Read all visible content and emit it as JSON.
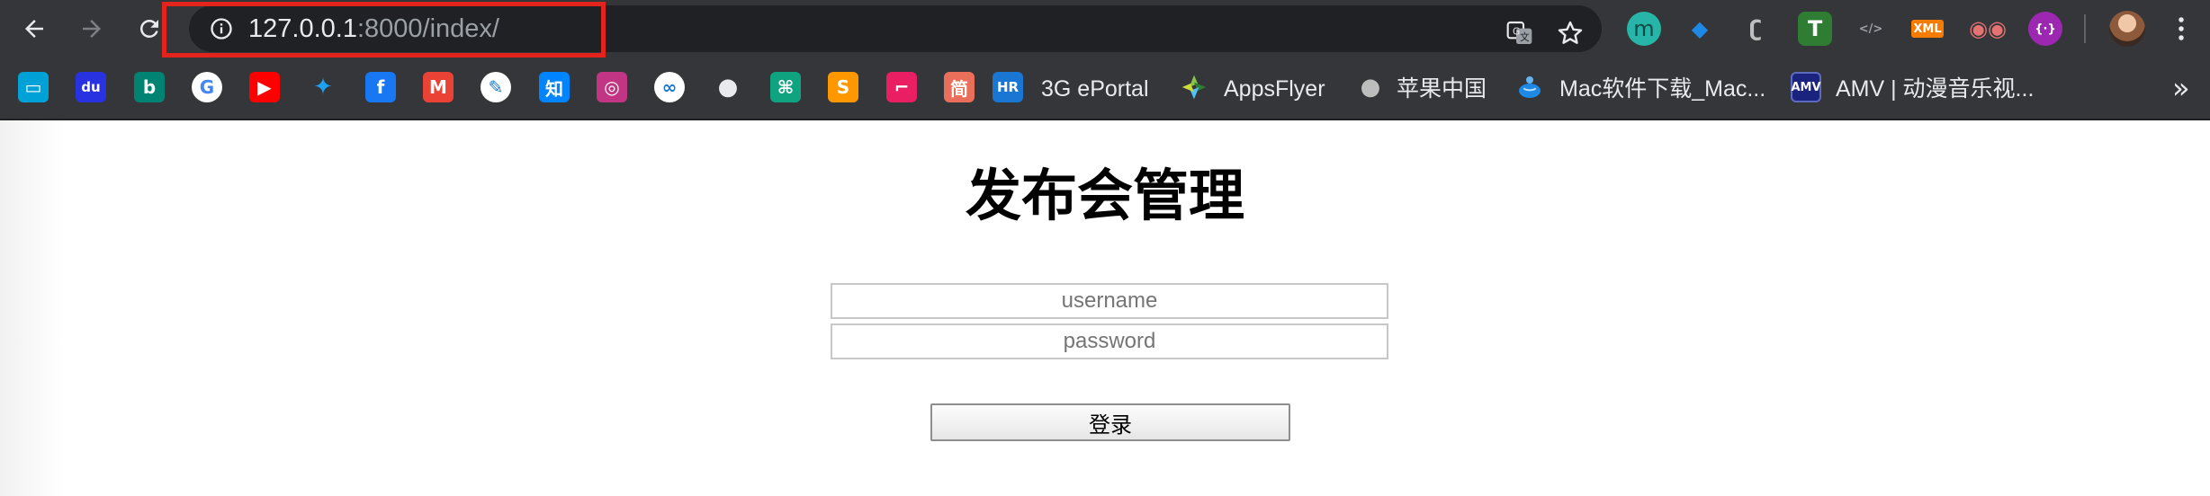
{
  "browser": {
    "url_host": "127.0.0.1",
    "url_rest": ":8000/index/",
    "extensions": [
      {
        "name": "m-extension-icon",
        "glyph": "m",
        "color": "#26b5a8"
      },
      {
        "name": "diamond-extension-icon",
        "glyph": "◆",
        "color": "#1e88e5"
      },
      {
        "name": "hook-extension-icon",
        "glyph": "ʗ",
        "color": "#bdbdbd"
      },
      {
        "name": "tampermonkey-icon",
        "glyph": "T",
        "color": "#2e7d32"
      },
      {
        "name": "code-extension-icon",
        "glyph": "</>",
        "color": "#9aa0a6"
      },
      {
        "name": "xml-extension-icon",
        "glyph": "XML",
        "color": "#f57c00"
      },
      {
        "name": "glasses-extension-icon",
        "glyph": "◉◉",
        "color": "#e57373"
      },
      {
        "name": "purple-extension-icon",
        "glyph": "{·}",
        "color": "#9c27b0"
      }
    ]
  },
  "bookmarks": [
    {
      "name": "bilibili-icon",
      "glyph": "▭",
      "color": "#00a1d6"
    },
    {
      "name": "baidu-icon",
      "glyph": "du",
      "color": "#2932e1"
    },
    {
      "name": "bing-icon",
      "glyph": "b",
      "color": "#008373"
    },
    {
      "name": "google-icon",
      "glyph": "G",
      "color": "#ffffff"
    },
    {
      "name": "youtube-icon",
      "glyph": "▶",
      "color": "#ff0000"
    },
    {
      "name": "twitter-icon",
      "glyph": "✦",
      "color": "#1da1f2"
    },
    {
      "name": "facebook-icon",
      "glyph": "f",
      "color": "#1877f2"
    },
    {
      "name": "gmail-icon",
      "glyph": "M",
      "color": "#ea4335"
    },
    {
      "name": "bird-icon",
      "glyph": "✎",
      "color": "#f5f5f5"
    },
    {
      "name": "zhihu-icon",
      "glyph": "知",
      "color": "#0084ff"
    },
    {
      "name": "instagram-icon",
      "glyph": "◎",
      "color": "#c13584"
    },
    {
      "name": "baidu-netdisk-icon",
      "glyph": "∞",
      "color": "#ffffff"
    },
    {
      "name": "github-icon",
      "glyph": "●",
      "color": "#24292e"
    },
    {
      "name": "chatgpt-icon",
      "glyph": "⌘",
      "color": "#10a37f"
    },
    {
      "name": "sublime-icon",
      "glyph": "S",
      "color": "#ff9800"
    },
    {
      "name": "bracket-icon",
      "glyph": "⌐",
      "color": "#e91e63"
    },
    {
      "name": "jianshu-icon",
      "glyph": "简",
      "color": "#ea6f5a"
    },
    {
      "name": "hr-icon",
      "glyph": "HR",
      "color": "#1976d2"
    }
  ],
  "labeled_bookmarks": [
    {
      "name": "bookmark-3g-eportal",
      "label": "3G ePortal"
    },
    {
      "name": "bookmark-appsflyer",
      "label": "AppsFlyer"
    },
    {
      "name": "bookmark-apple-china",
      "label": "苹果中国"
    },
    {
      "name": "bookmark-mac-software",
      "label": "Mac软件下载_Mac..."
    },
    {
      "name": "bookmark-amv",
      "label": "AMV | 动漫音乐视..."
    }
  ],
  "page": {
    "title": "发布会管理",
    "username_placeholder": "username",
    "password_placeholder": "password",
    "login_label": "登录"
  }
}
